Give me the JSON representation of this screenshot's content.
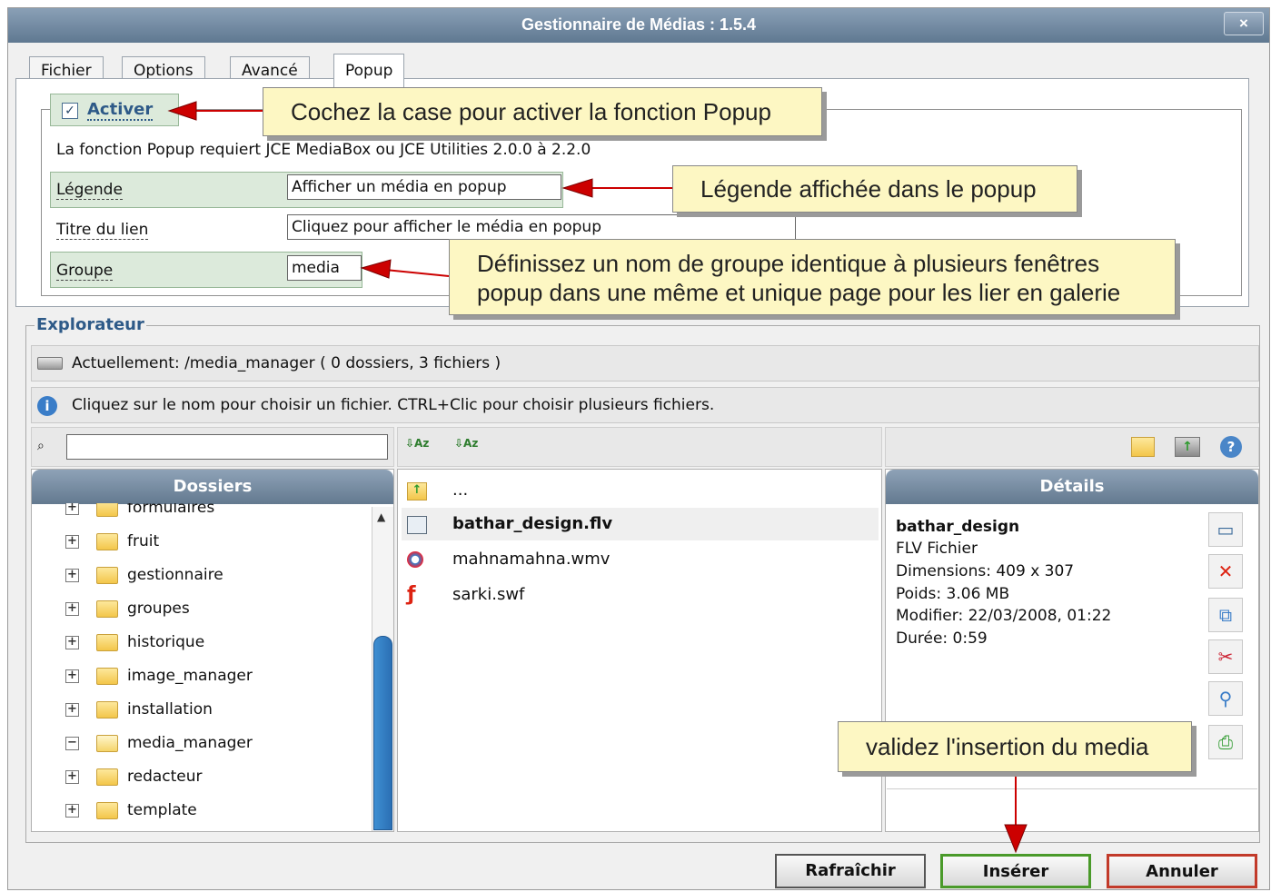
{
  "window": {
    "title": "Gestionnaire de Médias : 1.5.4",
    "close_label": "×"
  },
  "tabs": [
    "Fichier",
    "Options",
    "Avancé",
    "Popup"
  ],
  "active_tab": "Popup",
  "popup": {
    "activate_label": "Activer",
    "activate_checked": true,
    "requirement_text": "La fonction Popup requiert JCE MediaBox ou JCE Utilities 2.0.0 à 2.2.0",
    "legend_label": "Légende",
    "legend_value": "Afficher un média en popup",
    "link_title_label": "Titre du lien",
    "link_title_value": "Cliquez pour afficher le média en popup",
    "group_label": "Groupe",
    "group_value": "media"
  },
  "callouts": {
    "activate": "Cochez la case pour activer la fonction Popup",
    "legend": "Légende affichée dans le popup",
    "group_line1": "Définissez un nom de groupe identique à plusieurs fenêtres",
    "group_line2": "popup dans une même et unique page pour les lier en galerie",
    "insert": "validez l'insertion du media"
  },
  "explorer": {
    "legend": "Explorateur",
    "current_path": "Actuellement: /media_manager ( 0 dossiers, 3 fichiers )",
    "hint": "Cliquez sur le nom pour choisir un fichier. CTRL+Clic pour choisir plusieurs fichiers.",
    "search_value": "",
    "folders_header": "Dossiers",
    "folders": [
      {
        "name": "formulaires",
        "expand": "+"
      },
      {
        "name": "fruit",
        "expand": "+"
      },
      {
        "name": "gestionnaire",
        "expand": "+"
      },
      {
        "name": "groupes",
        "expand": "+"
      },
      {
        "name": "historique",
        "expand": "+"
      },
      {
        "name": "image_manager",
        "expand": "+"
      },
      {
        "name": "installation",
        "expand": "+"
      },
      {
        "name": "media_manager",
        "expand": "−"
      },
      {
        "name": "redacteur",
        "expand": "+"
      },
      {
        "name": "template",
        "expand": "+"
      }
    ],
    "parent_label": "...",
    "files": [
      {
        "name": "bathar_design.flv",
        "icon": "flv-file-icon",
        "selected": true
      },
      {
        "name": "mahnamahna.wmv",
        "icon": "wmv-file-icon",
        "selected": false
      },
      {
        "name": "sarki.swf",
        "icon": "swf-file-icon",
        "selected": false
      }
    ],
    "details_header": "Détails",
    "details": {
      "name": "bathar_design",
      "type": "FLV Fichier",
      "dimensions": "Dimensions: 409 x 307",
      "size": "Poids: 3.06 MB",
      "modified": "Modifier: 22/03/2008, 01:22",
      "duration": "Durée: 0:59"
    }
  },
  "buttons": {
    "refresh": "Rafraîchir",
    "insert": "Insérer",
    "cancel": "Annuler"
  },
  "colors": {
    "title_bar": "#6c849c",
    "callout_bg": "#fdf7c3",
    "arrow": "#cc0000",
    "insert_border": "#4a9a2a",
    "cancel_border": "#c23a2a",
    "accent_blue": "#2e5a88"
  }
}
